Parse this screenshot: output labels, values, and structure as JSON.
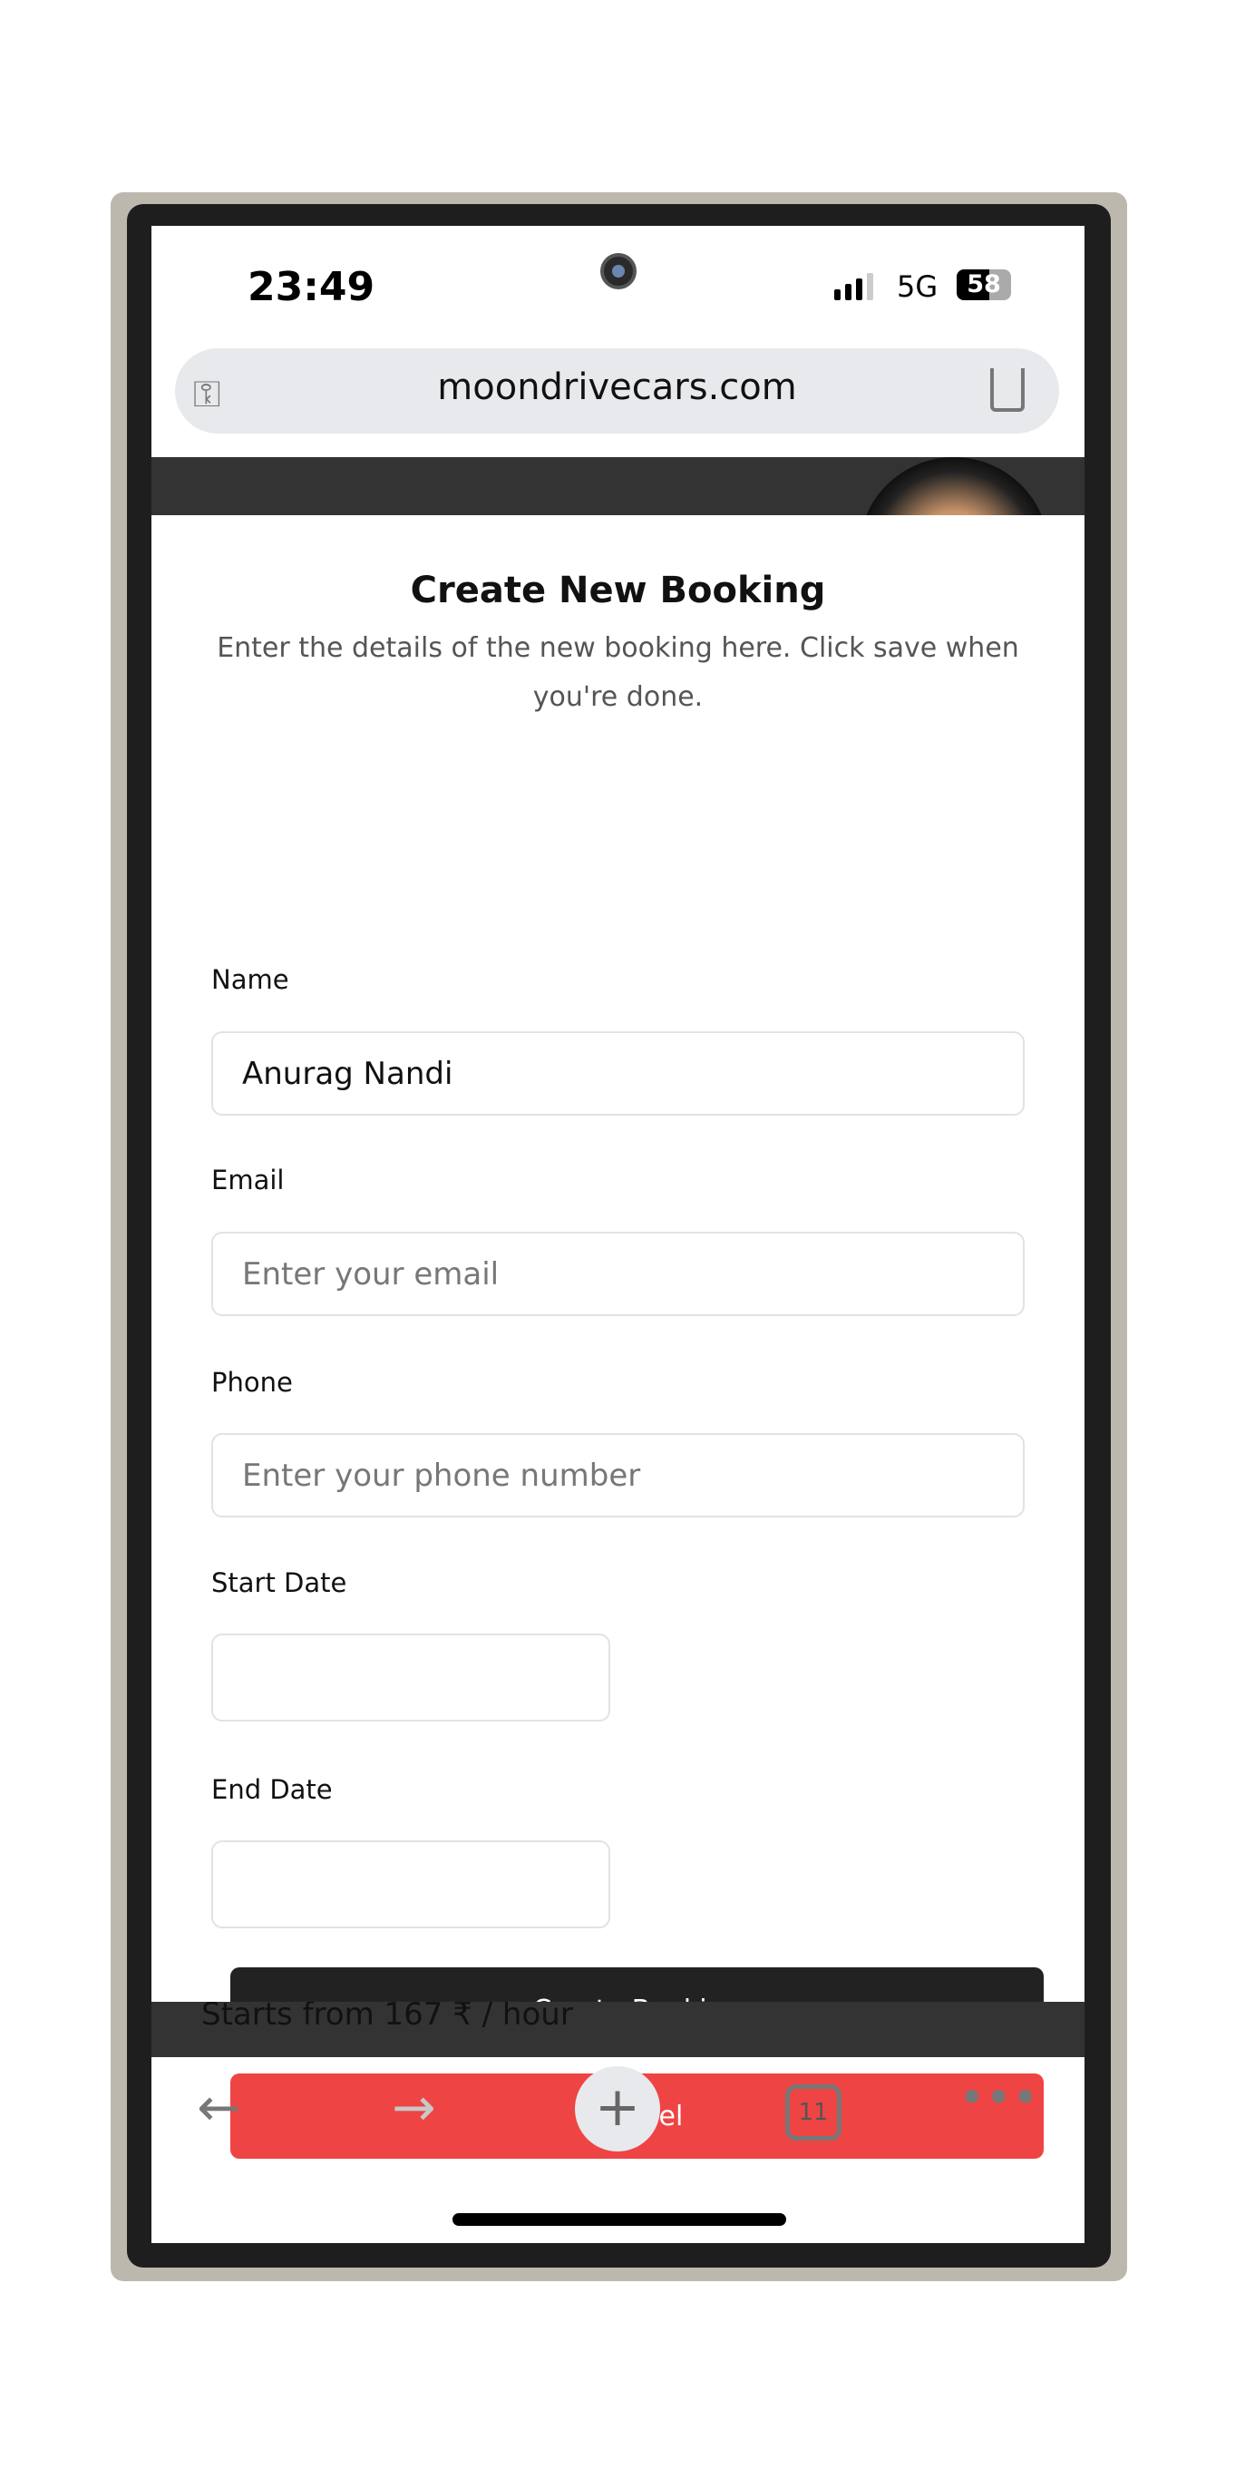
{
  "status_bar": {
    "time": "23:49",
    "network": "5G",
    "battery": "58"
  },
  "browser": {
    "url": "moondrivecars.com",
    "tab_count": "11"
  },
  "background_page": {
    "price_text": "Starts from 167 ₹ / hour"
  },
  "modal": {
    "title": "Create New Booking",
    "description": "Enter the details of the new booking here. Click save when you're done.",
    "fields": {
      "name": {
        "label": "Name",
        "value": "Anurag Nandi"
      },
      "email": {
        "label": "Email",
        "placeholder": "Enter your email"
      },
      "phone": {
        "label": "Phone",
        "placeholder": "Enter your phone number"
      },
      "start_date": {
        "label": "Start Date",
        "value": ""
      },
      "end_date": {
        "label": "End Date",
        "value": ""
      }
    },
    "submit_label": "Create Booking",
    "cancel_label": "Cancel"
  },
  "colors": {
    "primary": "#222222",
    "danger": "#ef4444"
  }
}
